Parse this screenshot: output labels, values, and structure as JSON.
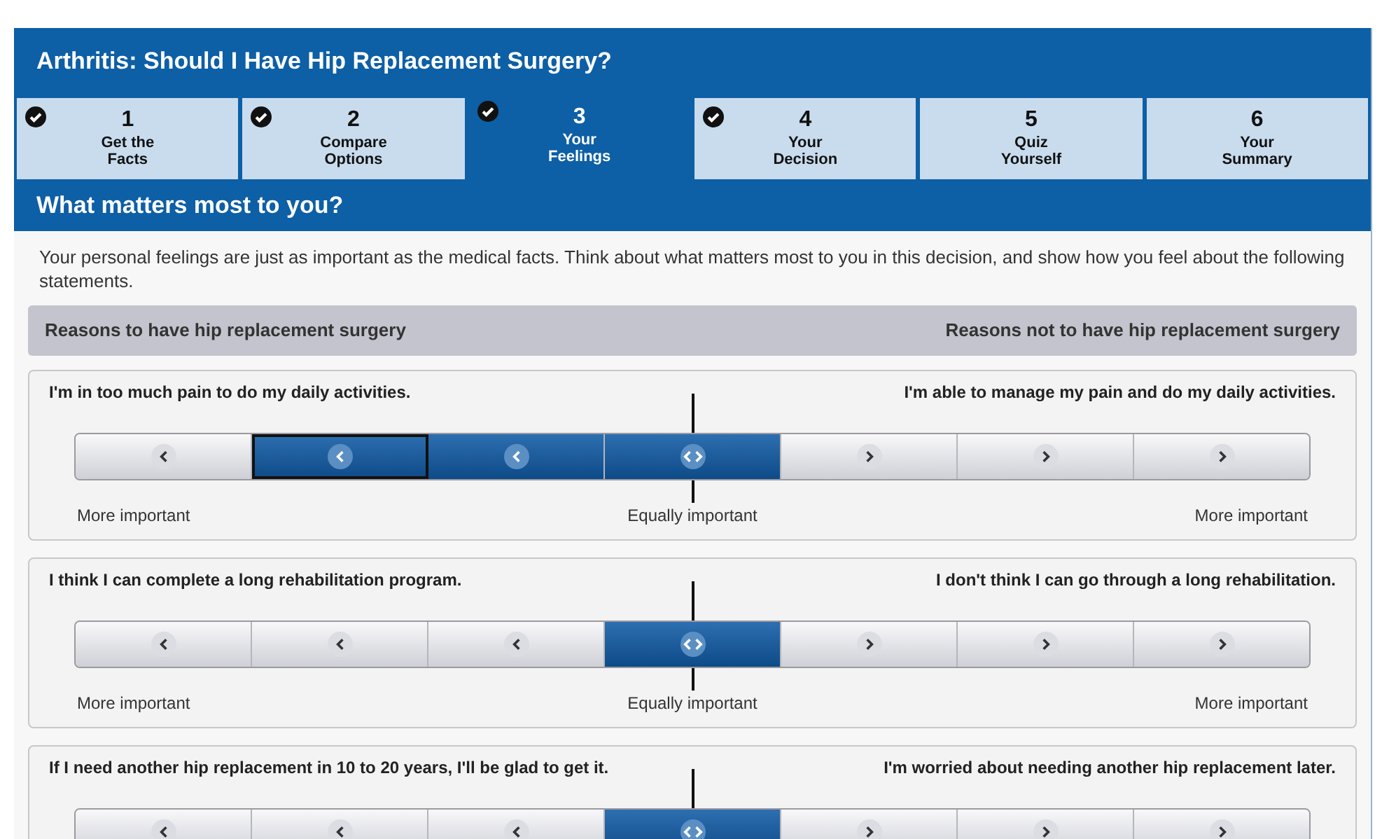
{
  "title": "Arthritis: Should I Have Hip Replacement Surgery?",
  "tabs": [
    {
      "number": "1",
      "label": "Get the Facts",
      "done": true,
      "selected": false
    },
    {
      "number": "2",
      "label": "Compare Options",
      "done": true,
      "selected": false
    },
    {
      "number": "3",
      "label": "Your Feelings",
      "done": true,
      "selected": true
    },
    {
      "number": "4",
      "label": "Your Decision",
      "done": true,
      "selected": false
    },
    {
      "number": "5",
      "label": "Quiz Yourself",
      "done": false,
      "selected": false
    },
    {
      "number": "6",
      "label": "Your Summary",
      "done": false,
      "selected": false
    }
  ],
  "section_title": "What matters most to you?",
  "intro": "Your personal feelings are just as important as the medical facts. Think about what matters most to you in this decision, and show how you feel about the following statements.",
  "columns_header": {
    "left": "Reasons to have hip replacement surgery",
    "right": "Reasons not to have hip replacement surgery"
  },
  "statements": [
    {
      "left": "I'm in too much pain to do my daily activities.",
      "right": "I'm able to manage my pain and do my daily activities.",
      "scale_left": "More important",
      "scale_center": "Equally important",
      "scale_right": "More important",
      "segments": [
        {
          "kind": "left",
          "filled": false,
          "focused": false
        },
        {
          "kind": "left",
          "filled": true,
          "focused": true
        },
        {
          "kind": "left",
          "filled": true,
          "focused": false
        },
        {
          "kind": "center",
          "filled": true,
          "focused": false
        },
        {
          "kind": "right",
          "filled": false,
          "focused": false
        },
        {
          "kind": "right",
          "filled": false,
          "focused": false
        },
        {
          "kind": "right",
          "filled": false,
          "focused": false
        }
      ]
    },
    {
      "left": "I think I can complete a long rehabilitation program.",
      "right": "I don't think I can go through a long rehabilitation.",
      "scale_left": "More important",
      "scale_center": "Equally important",
      "scale_right": "More important",
      "segments": [
        {
          "kind": "left",
          "filled": false,
          "focused": false
        },
        {
          "kind": "left",
          "filled": false,
          "focused": false
        },
        {
          "kind": "left",
          "filled": false,
          "focused": false
        },
        {
          "kind": "center",
          "filled": true,
          "focused": false
        },
        {
          "kind": "right",
          "filled": false,
          "focused": false
        },
        {
          "kind": "right",
          "filled": false,
          "focused": false
        },
        {
          "kind": "right",
          "filled": false,
          "focused": false
        }
      ]
    },
    {
      "left": "If I need another hip replacement in 10 to 20 years, I'll be glad to get it.",
      "right": "I'm worried about needing another hip replacement later.",
      "segments": [
        {
          "kind": "left",
          "filled": false,
          "focused": false
        },
        {
          "kind": "left",
          "filled": false,
          "focused": false
        },
        {
          "kind": "left",
          "filled": false,
          "focused": false
        },
        {
          "kind": "center",
          "filled": true,
          "focused": false
        },
        {
          "kind": "right",
          "filled": false,
          "focused": false
        },
        {
          "kind": "right",
          "filled": false,
          "focused": false
        },
        {
          "kind": "right",
          "filled": false,
          "focused": false
        }
      ]
    }
  ]
}
